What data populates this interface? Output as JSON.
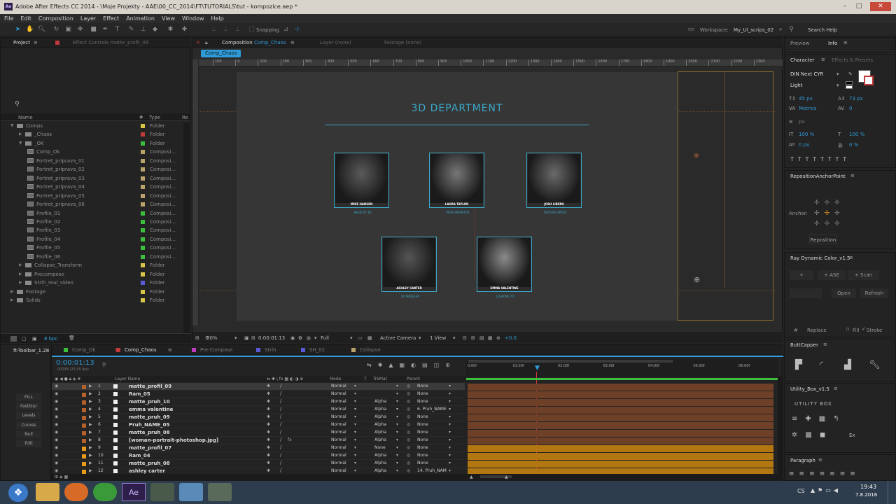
{
  "window": {
    "title": "Adobe After Effects CC 2014 - \\Moje Projekty - AAE\\00_CC_2014\\FT\\TUTORIALS\\tut - kompozice.aep *",
    "icon": "Ae",
    "controls": [
      "–",
      "□",
      "✕"
    ]
  },
  "menu": [
    "File",
    "Edit",
    "Composition",
    "Layer",
    "Effect",
    "Animation",
    "View",
    "Window",
    "Help"
  ],
  "toolbar": {
    "snapping": "Snapping",
    "workspace_label": "Workspace:",
    "workspace_value": "My_UI_scrips_02",
    "search_help": "Search Help",
    "tools": [
      "selection-tool-icon",
      "hand-tool-icon",
      "zoom-tool-icon",
      "rotate-tool-icon",
      "camera-tool-icon",
      "pan-behind-icon",
      "mask-tool-icon",
      "pen-tool-icon",
      "type-tool-icon",
      "brush-tool-icon",
      "clone-tool-icon",
      "eraser-tool-icon",
      "roto-brush-icon",
      "puppet-tool-icon"
    ]
  },
  "project": {
    "tab": "Project",
    "effect_controls": "Effect Controls matte_profil_09",
    "search_placeholder": "",
    "col_name": "Name",
    "col_type": "Type",
    "col_size": "Re",
    "items": [
      {
        "name": "Comps",
        "type": "Folder",
        "color": "#d8c548",
        "indent": 0,
        "tri": "▼",
        "icon": "folder"
      },
      {
        "name": "_Chaos",
        "type": "Folder",
        "color": "#c03a3a",
        "indent": 1,
        "tri": "▶",
        "icon": "folder"
      },
      {
        "name": "_OK",
        "type": "Folder",
        "color": "#3cbf3c",
        "indent": 1,
        "tri": "▼",
        "icon": "folder"
      },
      {
        "name": "Comp_Ok",
        "type": "Composi...",
        "color": "#b9a36a",
        "indent": 2,
        "tri": "",
        "icon": "comp"
      },
      {
        "name": "Portret_priprava_01",
        "type": "Composi...",
        "color": "#b9a36a",
        "indent": 2,
        "tri": "",
        "icon": "comp"
      },
      {
        "name": "Portret_priprava_02",
        "type": "Composi...",
        "color": "#b9a36a",
        "indent": 2,
        "tri": "",
        "icon": "comp"
      },
      {
        "name": "Portret_priprava_03",
        "type": "Composi...",
        "color": "#b9a36a",
        "indent": 2,
        "tri": "",
        "icon": "comp"
      },
      {
        "name": "Portret_priprava_04",
        "type": "Composi...",
        "color": "#b9a36a",
        "indent": 2,
        "tri": "",
        "icon": "comp"
      },
      {
        "name": "Portret_priprava_05",
        "type": "Composi...",
        "color": "#b9a36a",
        "indent": 2,
        "tri": "",
        "icon": "comp"
      },
      {
        "name": "Portret_priprava_06",
        "type": "Composi...",
        "color": "#b9a36a",
        "indent": 2,
        "tri": "",
        "icon": "comp"
      },
      {
        "name": "Profile_01",
        "type": "Composi...",
        "color": "#3cbf3c",
        "indent": 2,
        "tri": "",
        "icon": "comp"
      },
      {
        "name": "Profile_02",
        "type": "Composi...",
        "color": "#3cbf3c",
        "indent": 2,
        "tri": "",
        "icon": "comp"
      },
      {
        "name": "Profile_03",
        "type": "Composi...",
        "color": "#3cbf3c",
        "indent": 2,
        "tri": "",
        "icon": "comp"
      },
      {
        "name": "Profile_04",
        "type": "Composi...",
        "color": "#3cbf3c",
        "indent": 2,
        "tri": "",
        "icon": "comp"
      },
      {
        "name": "Profile_05",
        "type": "Composi...",
        "color": "#3cbf3c",
        "indent": 2,
        "tri": "",
        "icon": "comp"
      },
      {
        "name": "Profile_06",
        "type": "Composi...",
        "color": "#3cbf3c",
        "indent": 2,
        "tri": "",
        "icon": "comp"
      },
      {
        "name": "Collapse_Transform",
        "type": "Folder",
        "color": "#d8c548",
        "indent": 1,
        "tri": "▶",
        "icon": "folder"
      },
      {
        "name": "Precompose",
        "type": "Folder",
        "color": "#d8c548",
        "indent": 1,
        "tri": "▶",
        "icon": "folder"
      },
      {
        "name": "Strih_real_video",
        "type": "Folder",
        "color": "#5a5ad8",
        "indent": 1,
        "tri": "▶",
        "icon": "folder"
      },
      {
        "name": "Footage",
        "type": "Folder",
        "color": "#d8c548",
        "indent": 0,
        "tri": "▶",
        "icon": "folder"
      },
      {
        "name": "Solids",
        "type": "Folder",
        "color": "#d8c548",
        "indent": 0,
        "tri": "▶",
        "icon": "folder"
      }
    ],
    "bpc": "8 bpc"
  },
  "comp_panel": {
    "tab_prefix": "Composition",
    "tab_name": "Comp_Chaos",
    "layer_tab": "Layer (none)",
    "footage_tab": "Footage (none)",
    "sub_tab": "Comp_Chaos",
    "ruler": [
      "100",
      "0",
      "100",
      "200",
      "300",
      "400",
      "500",
      "600",
      "700",
      "800",
      "900",
      "1000",
      "1100",
      "1200",
      "1300",
      "1400",
      "1500",
      "1600",
      "1700",
      "1800",
      "1900",
      "2000",
      "2100",
      "2200",
      "2300"
    ],
    "heading": "3D DEPARTMENT",
    "people": [
      {
        "name": "MIKE HANSEN",
        "role": "HEAD OF 3D",
        "tone": "#5a5a5a"
      },
      {
        "name": "LAURA TAYLOR",
        "role": "MAYA ANIMATOR",
        "tone": "#777"
      },
      {
        "name": "JOSH LIBENS",
        "role": "TEXTURE ARTIST",
        "tone": "#6a6a6a"
      },
      {
        "name": "ASHLEY CARTER",
        "role": "3D MODELER",
        "tone": "#555"
      },
      {
        "name": "EMMA VALENTINE",
        "role": "LIGHTING TD",
        "tone": "#8a8a8a"
      }
    ],
    "zoom": "50%",
    "timecode": "0:00:01:13",
    "resolution": "Full",
    "camera": "Active Camera",
    "view": "1 View",
    "exposure": "+0.0"
  },
  "right": {
    "preview_tab": "Preview",
    "info_tab": "Info",
    "character_tab": "Character",
    "effects_tab": "Effects & Presets",
    "font": "DIN Next CYR",
    "style": "Light",
    "size": "45 px",
    "leading": "73 px",
    "kerning": "Metrics",
    "tracking": "0",
    "vscale": "100 %",
    "hscale": "100 %",
    "baseline": "0 px",
    "tsume": "0 %",
    "unit_px": "px",
    "reposition_title": "RepositionAnchorPoint",
    "anchor_label": "Anchor:",
    "reposition_btn": "Reposition",
    "ray_title": "Ray Dynamic Color_v1.5",
    "ray_plus": "+",
    "ray_ase": "+ ASE",
    "ray_scan": "+ Scan",
    "ray_open": "Open",
    "ray_refresh": "Refresh",
    "ray_replace": "Replace",
    "ray_fill": "Fill",
    "ray_stroke": "Stroke",
    "buttcapper": "ButtCapper",
    "utility": "Utility_Box_v1.5",
    "utility_logo": "UTILITY BOX",
    "paragraph": "Paragraph"
  },
  "ft_toolbar": {
    "title": "ft-Toolbar_1.28",
    "buttons": [
      "FILL",
      "Fastblur",
      "Levels",
      "Curves",
      "Null",
      "Edit"
    ]
  },
  "timeline": {
    "tabs": [
      {
        "name": "Comp_Ok",
        "color": "#3cbf3c"
      },
      {
        "name": "Comp_Chaos",
        "color": "#c03a3a"
      },
      {
        "name": "Pre-Compose",
        "color": "#c03ac0"
      },
      {
        "name": "Strih",
        "color": "#5a5ad8"
      },
      {
        "name": "SH_02",
        "color": "#5a5ad8"
      },
      {
        "name": "Collapse",
        "color": "#b9a36a"
      }
    ],
    "timecode": "0:00:01:13",
    "fps": "00038 (25.00 fps)",
    "col_layer": "Layer Name",
    "col_mode": "Mode",
    "col_t": "T",
    "col_trkmat": "TrkMat",
    "col_parent": "Parent",
    "ruler": [
      "0:00f",
      "01:00f",
      "02:00f",
      "03:00f",
      "04:00f",
      "05:00f",
      "06:00f"
    ],
    "layers": [
      {
        "n": "1",
        "name": "matte_profil_09",
        "mode": "Normal",
        "trk": "",
        "parent": "None",
        "color": "#b5612b",
        "fx": false
      },
      {
        "n": "2",
        "name": "Ram_05",
        "mode": "Normal",
        "trk": "",
        "parent": "None",
        "color": "#b5612b",
        "fx": false
      },
      {
        "n": "3",
        "name": "matte_pruh_10",
        "mode": "Normal",
        "trk": "Alpha",
        "parent": "None",
        "color": "#b5612b",
        "fx": false
      },
      {
        "n": "4",
        "name": "emma valentine",
        "mode": "Normal",
        "trk": "Alpha",
        "parent": "6. Pruh_NAME",
        "color": "#b5612b",
        "fx": false
      },
      {
        "n": "5",
        "name": "matte_pruh_09",
        "mode": "Normal",
        "trk": "Alpha",
        "parent": "None",
        "color": "#b5612b",
        "fx": false
      },
      {
        "n": "6",
        "name": "Pruh_NAME_05",
        "mode": "Normal",
        "trk": "Alpha",
        "parent": "None",
        "color": "#b5612b",
        "fx": false
      },
      {
        "n": "7",
        "name": "matte_pruh_08",
        "mode": "Normal",
        "trk": "Alpha",
        "parent": "None",
        "color": "#b5612b",
        "fx": false
      },
      {
        "n": "8",
        "name": "[woman-portrait-photoshop.jpg]",
        "mode": "Normal",
        "trk": "Alpha",
        "parent": "None",
        "color": "#b5612b",
        "fx": true
      },
      {
        "n": "9",
        "name": "matte_profil_07",
        "mode": "Normal",
        "trk": "None",
        "parent": "None",
        "color": "#e89a1a",
        "fx": false
      },
      {
        "n": "10",
        "name": "Ram_04",
        "mode": "Normal",
        "trk": "Alpha",
        "parent": "None",
        "color": "#e89a1a",
        "fx": false
      },
      {
        "n": "11",
        "name": "matte_pruh_08",
        "mode": "Normal",
        "trk": "Alpha",
        "parent": "None",
        "color": "#e89a1a",
        "fx": false
      },
      {
        "n": "12",
        "name": "ashley carter",
        "mode": "Normal",
        "trk": "Alpha",
        "parent": "14. Pruh_NAM",
        "color": "#e89a1a",
        "fx": false
      }
    ]
  },
  "taskbar": {
    "lang": "CS",
    "time": "19:43",
    "date": "7.8.2016",
    "apps": [
      "explorer-icon",
      "firefox-icon",
      "chrome-icon",
      "after-effects-icon",
      "app5-icon",
      "app6-icon",
      "app7-icon"
    ]
  }
}
